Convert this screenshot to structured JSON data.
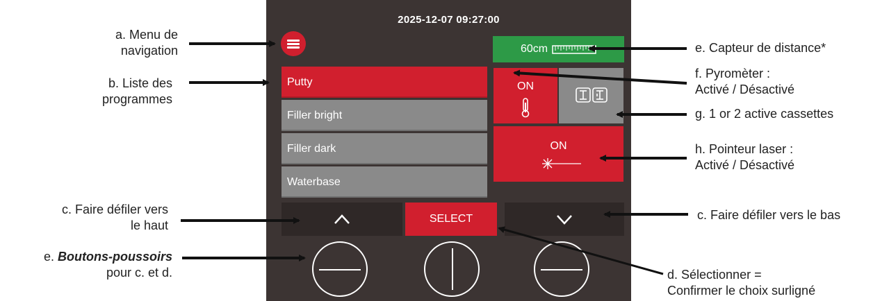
{
  "screen": {
    "timestamp": "2025-12-07 09:27:00",
    "menu_icon": "hamburger-icon",
    "programs": [
      {
        "label": "Putty",
        "selected": true
      },
      {
        "label": "Filler bright",
        "selected": false
      },
      {
        "label": "Filler dark",
        "selected": false
      },
      {
        "label": "Waterbase",
        "selected": false
      }
    ],
    "distance_value": "60cm",
    "pyrometer_state": "ON",
    "laser_state": "ON",
    "select_label": "SELECT"
  },
  "labels": {
    "a_line1": "a. Menu de",
    "a_line2": "navigation",
    "b_line1": "b. Liste des",
    "b_line2": "programmes",
    "c_left_line1": "c. Faire défiler vers",
    "c_left_line2": "le haut",
    "e_left_bold": "Boutons-poussoirs",
    "e_left_prefix": "e.",
    "e_left_line2": "pour c. et d.",
    "e_right": "e. Capteur de distance*",
    "f_line1": "f.  Pyromèter :",
    "f_line2": "Activé / Désactivé",
    "g": "g. 1 or 2 active cassettes",
    "h_line1": "h. Pointeur laser :",
    "h_line2": "Activé / Désactivé",
    "c_right": "c. Faire défiler vers le bas",
    "d_line1": "d. Sélectionner =",
    "d_line2": "Confirmer le choix surligné"
  },
  "colors": {
    "accent_red": "#d11f2e",
    "screen_bg": "#3c3433",
    "tile_grey": "#8a8a8a",
    "distance_green": "#2d9a47"
  }
}
